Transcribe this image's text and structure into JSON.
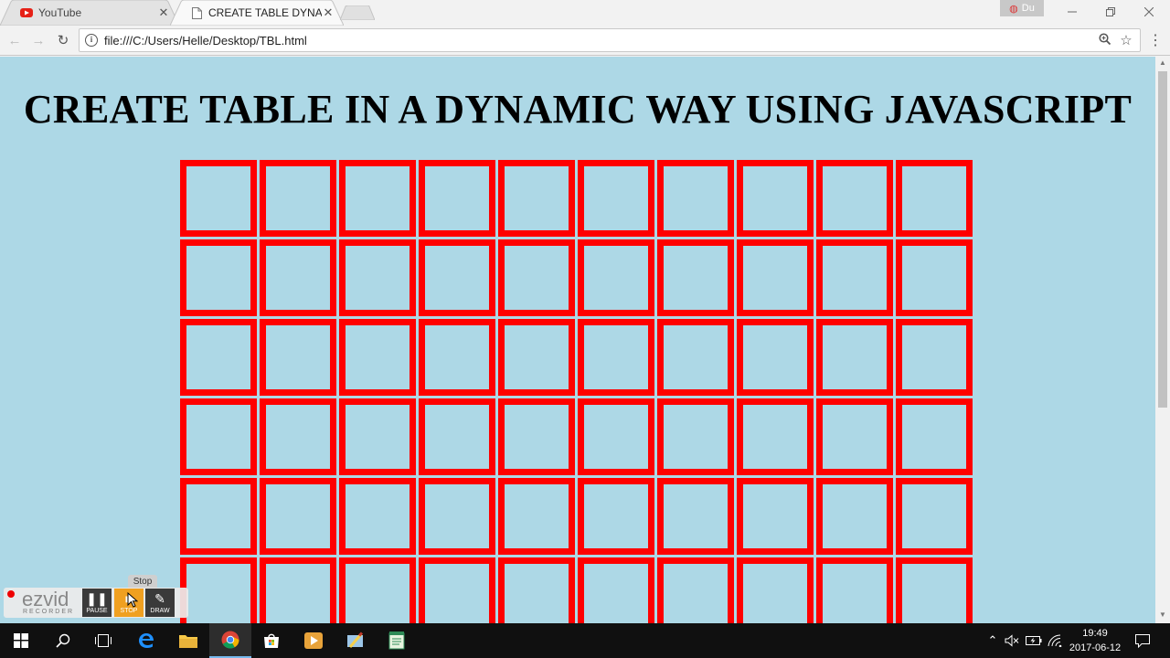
{
  "browser": {
    "tabs": [
      {
        "title": "YouTube",
        "icon": "youtube-icon",
        "active": false
      },
      {
        "title": "CREATE TABLE DYNAMIC",
        "icon": "document-icon",
        "active": true
      }
    ],
    "profile_label": "Du",
    "url": "file:///C:/Users/Helle/Desktop/TBL.html"
  },
  "page": {
    "heading": "CREATE TABLE IN A DYNAMIC WAY USING JAVASCRIPT",
    "table": {
      "visible_rows": 6,
      "columns": 10
    },
    "colors": {
      "background": "#add8e6",
      "cell_border": "#ff0000"
    }
  },
  "ezvid": {
    "logo": "ezvid",
    "logo_sub": "RECORDER",
    "buttons": {
      "pause": "PAUSE",
      "stop": "STOP",
      "draw": "DRAW"
    },
    "tooltip": "Stop"
  },
  "taskbar": {
    "time": "19:49",
    "date": "2017-06-12"
  }
}
